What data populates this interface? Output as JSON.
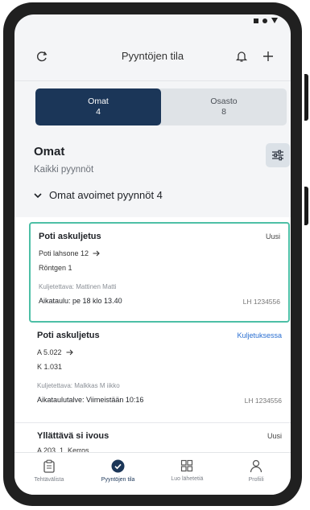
{
  "status_bar": {
    "icons": [
      "signal-square-icon",
      "dot-icon",
      "wifi-triangle-icon"
    ]
  },
  "appbar": {
    "title": "Pyyntöjen tila",
    "left_icon": "refresh-icon",
    "right_icons": [
      "bell-icon",
      "plus-icon"
    ]
  },
  "segments": [
    {
      "label": "Omat",
      "count": "4",
      "selected": true
    },
    {
      "label": "Osasto",
      "count": "8",
      "selected": false
    }
  ],
  "section": {
    "title": "Omat",
    "subtitle": "Kaikki pyynnöt",
    "filter_icon": "sliders-icon"
  },
  "group": {
    "label": "Omat avoimet pyynnöt 4",
    "icon": "chevron-down-icon"
  },
  "cards": [
    {
      "title": "Poti askuljetus",
      "status": "Uusi",
      "from": "Poti lahsone 12",
      "to": "Röntgen 1",
      "muted": "Kuljetettava: Mattinen Matti",
      "bold": "Aikataulu: pe 18 klo 13.40",
      "id": "LH 1234556",
      "highlighted": true
    },
    {
      "title": "Poti askuljetus",
      "status": "Kuljetuksessa",
      "from": "A 5.022",
      "to": "K 1.031",
      "muted": "Kuljetettava: Malkkas M iikko",
      "bold": "Aikataulutalve: Viimeistään 10:16",
      "id": "LH 1234556",
      "highlighted": false
    },
    {
      "title": "Yllättävä si ivous",
      "status": "Uusi",
      "from": "A 203, 1. Kerros",
      "to": "",
      "muted": "",
      "bold": "",
      "id": "",
      "highlighted": false
    }
  ],
  "bottom_nav": [
    {
      "label": "Tehtävälista",
      "icon": "clipboard-icon",
      "active": false
    },
    {
      "label": "Pyyntöjen tila",
      "icon": "check-circle-icon",
      "active": true
    },
    {
      "label": "Luo lähetetiä",
      "icon": "grid-icon",
      "active": false
    },
    {
      "label": "Profiili",
      "icon": "user-icon",
      "active": false
    }
  ],
  "colors": {
    "accent": "#1b3658",
    "highlight": "#4dbfa6",
    "link": "#2a6fd1",
    "device": "#202020"
  }
}
